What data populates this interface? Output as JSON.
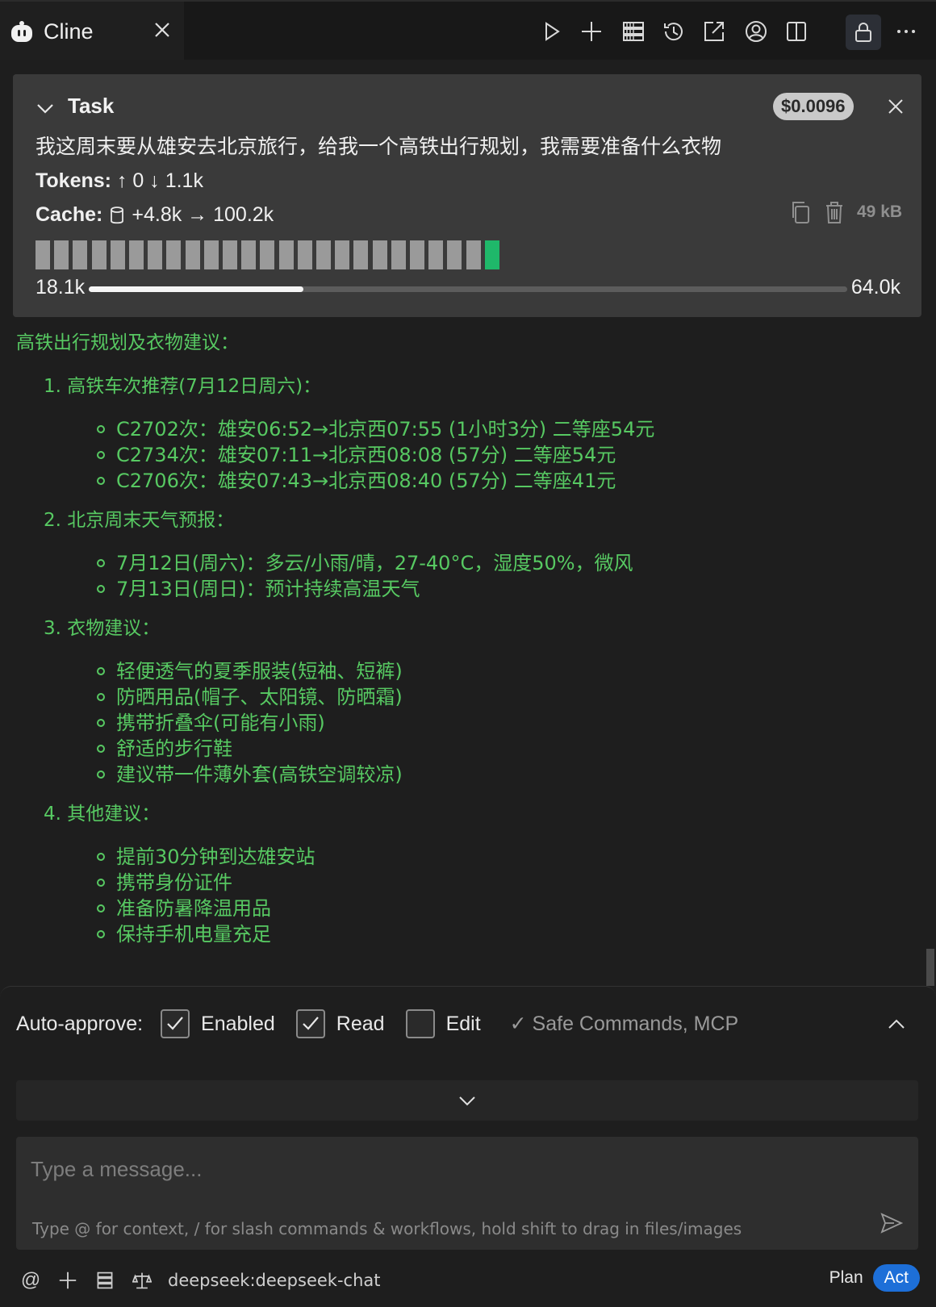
{
  "tab": {
    "title": "Cline"
  },
  "task": {
    "title": "Task",
    "cost": "$0.0096",
    "text": "我这周末要从雄安去北京旅行，给我一个高铁出行规划，我需要准备什么衣物",
    "tokens_label": "Tokens:",
    "tokens_value": "↑ 0 ↓ 1.1k",
    "cache_label": "Cache:",
    "cache_value": "+4.8k → 100.2k",
    "size": "49 kB",
    "context_used": "18.1k",
    "context_max": "64.0k",
    "context_fraction": 0.283,
    "segments": 25
  },
  "message": {
    "heading": "高铁出行规划及衣物建议：",
    "sections": [
      {
        "title": "1. 高铁车次推荐(7月12日周六)：",
        "items": [
          "C2702次：雄安06:52→北京西07:55 (1小时3分) 二等座54元",
          "C2734次：雄安07:11→北京西08:08 (57分) 二等座54元",
          "C2706次：雄安07:43→北京西08:40 (57分) 二等座41元"
        ]
      },
      {
        "title": "2. 北京周末天气预报：",
        "items": [
          "7月12日(周六)：多云/小雨/晴，27-40°C，湿度50%，微风",
          "7月13日(周日)：预计持续高温天气"
        ]
      },
      {
        "title": "3. 衣物建议：",
        "items": [
          "轻便透气的夏季服装(短袖、短裤)",
          "防晒用品(帽子、太阳镜、防晒霜)",
          "携带折叠伞(可能有小雨)",
          "舒适的步行鞋",
          "建议带一件薄外套(高铁空调较凉)"
        ]
      },
      {
        "title": "4. 其他建议：",
        "items": [
          "提前30分钟到达雄安站",
          "携带身份证件",
          "准备防暑降温用品",
          "保持手机电量充足"
        ]
      }
    ]
  },
  "auto_approve": {
    "label": "Auto-approve:",
    "options": [
      {
        "label": "Enabled",
        "checked": true
      },
      {
        "label": "Read",
        "checked": true
      },
      {
        "label": "Edit",
        "checked": false
      }
    ],
    "summary": "✓ Safe Commands, MCP"
  },
  "input": {
    "placeholder": "Type a message...",
    "hint": "Type @ for context, / for slash commands & workflows, hold shift to drag in files/images"
  },
  "footer": {
    "at_symbol": "@",
    "model": "deepseek:deepseek-chat",
    "plan_label": "Plan",
    "act_label": "Act"
  },
  "colors": {
    "accent_green": "#57c962",
    "segment_green": "#1fb86a",
    "act_blue": "#1d6fd8"
  }
}
